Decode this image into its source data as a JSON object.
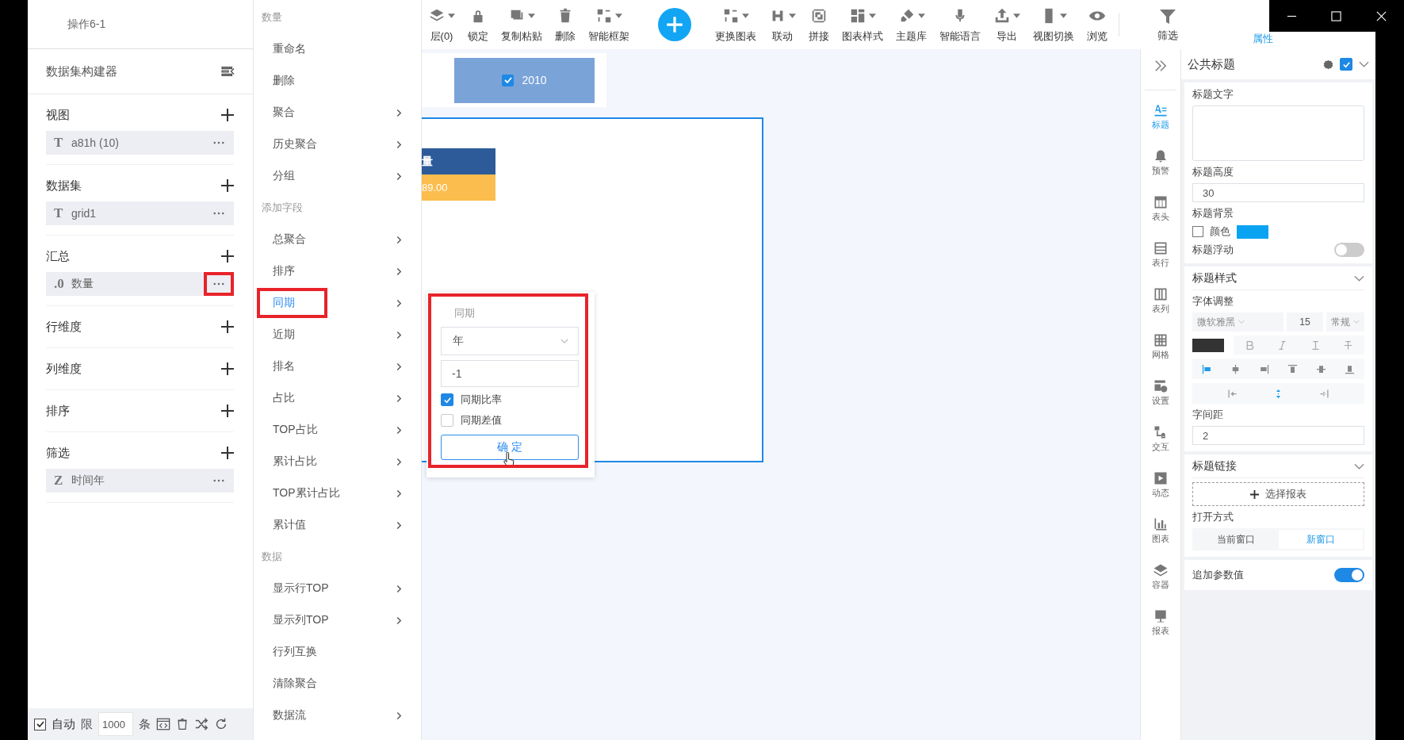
{
  "app_title": "操作6-1",
  "builder": {
    "title": "数据集构建器",
    "sections": [
      {
        "label": "视图",
        "fields": [
          {
            "type": "T",
            "name": "a81h (10)",
            "highlighted": false
          }
        ]
      },
      {
        "label": "数据集",
        "fields": [
          {
            "type": "T",
            "name": "grid1",
            "highlighted": false
          }
        ]
      },
      {
        "label": "汇总",
        "fields": [
          {
            "type": ".0",
            "name": "数量",
            "highlighted": true
          }
        ]
      },
      {
        "label": "行维度"
      },
      {
        "label": "列维度"
      },
      {
        "label": "排序"
      },
      {
        "label": "筛选",
        "fields": [
          {
            "type": "Z",
            "name": "时间年",
            "highlighted": false
          }
        ]
      }
    ],
    "footer": {
      "auto_checked": true,
      "auto_label": "自动",
      "limit_label": "限",
      "limit_value": "1000",
      "unit": "条"
    }
  },
  "context_menu": {
    "items": [
      {
        "kind": "group",
        "label": "数量"
      },
      {
        "kind": "item",
        "label": "重命名",
        "submenu": false,
        "selected": false
      },
      {
        "kind": "item",
        "label": "删除",
        "submenu": false,
        "selected": false
      },
      {
        "kind": "item",
        "label": "聚合",
        "submenu": true,
        "selected": false
      },
      {
        "kind": "item",
        "label": "历史聚合",
        "submenu": true,
        "selected": false
      },
      {
        "kind": "item",
        "label": "分组",
        "submenu": true,
        "selected": false
      },
      {
        "kind": "group",
        "label": "添加字段"
      },
      {
        "kind": "item",
        "label": "总聚合",
        "submenu": true,
        "selected": false
      },
      {
        "kind": "item",
        "label": "排序",
        "submenu": true,
        "selected": false
      },
      {
        "kind": "item",
        "label": "同期",
        "submenu": true,
        "selected": true
      },
      {
        "kind": "item",
        "label": "近期",
        "submenu": true,
        "selected": false
      },
      {
        "kind": "item",
        "label": "排名",
        "submenu": true,
        "selected": false
      },
      {
        "kind": "item",
        "label": "占比",
        "submenu": true,
        "selected": false
      },
      {
        "kind": "item",
        "label": "TOP占比",
        "submenu": true,
        "selected": false
      },
      {
        "kind": "item",
        "label": "累计占比",
        "submenu": true,
        "selected": false
      },
      {
        "kind": "item",
        "label": "TOP累计占比",
        "submenu": true,
        "selected": false
      },
      {
        "kind": "item",
        "label": "累计值",
        "submenu": true,
        "selected": false
      },
      {
        "kind": "group",
        "label": "数据"
      },
      {
        "kind": "item",
        "label": "显示行TOP",
        "submenu": true,
        "selected": false
      },
      {
        "kind": "item",
        "label": "显示列TOP",
        "submenu": true,
        "selected": false
      },
      {
        "kind": "item",
        "label": "行列互换",
        "submenu": false,
        "selected": false
      },
      {
        "kind": "item",
        "label": "清除聚合",
        "submenu": false,
        "selected": false
      },
      {
        "kind": "item",
        "label": "数据流",
        "submenu": true,
        "selected": false
      }
    ]
  },
  "toolbar": {
    "items": [
      {
        "kind": "tool",
        "label": "层(0)",
        "dropdown": true
      },
      {
        "kind": "tool",
        "label": "锁定",
        "dropdown": false
      },
      {
        "kind": "tool",
        "label": "复制粘贴",
        "dropdown": true
      },
      {
        "kind": "tool",
        "label": "删除",
        "dropdown": false
      },
      {
        "kind": "tool",
        "label": "智能框架",
        "dropdown": true
      },
      {
        "kind": "add"
      },
      {
        "kind": "tool",
        "label": "更换图表",
        "dropdown": true
      },
      {
        "kind": "tool",
        "label": "联动",
        "dropdown": true
      },
      {
        "kind": "tool",
        "label": "拼接",
        "dropdown": false
      },
      {
        "kind": "tool",
        "label": "图表样式",
        "dropdown": true
      },
      {
        "kind": "tool",
        "label": "主题库",
        "dropdown": true
      },
      {
        "kind": "tool",
        "label": "智能语言",
        "dropdown": false
      },
      {
        "kind": "tool",
        "label": "导出",
        "dropdown": true
      },
      {
        "kind": "tool",
        "label": "视图切换",
        "dropdown": true
      },
      {
        "kind": "tool",
        "label": "浏览",
        "dropdown": false
      }
    ],
    "tabs": [
      {
        "label": "筛选",
        "selected": false
      },
      {
        "label": "属性",
        "selected": true
      }
    ]
  },
  "canvas": {
    "filter_chip": {
      "label": "2010",
      "checked": true
    },
    "table": {
      "header": "量",
      "value": "89.00"
    }
  },
  "popup": {
    "title": "同期",
    "select": "年",
    "input": "-1",
    "highlighted": true,
    "options": [
      {
        "label": "同期比率",
        "checked": true
      },
      {
        "label": "同期差值",
        "checked": false
      }
    ],
    "button": "确 定"
  },
  "side_tabs": [
    {
      "label": "标题",
      "selected": true
    },
    {
      "label": "预警",
      "selected": false
    },
    {
      "label": "表头",
      "selected": false
    },
    {
      "label": "表行",
      "selected": false
    },
    {
      "label": "表列",
      "selected": false
    },
    {
      "label": "网格",
      "selected": false
    },
    {
      "label": "设置",
      "selected": false
    },
    {
      "label": "交互",
      "selected": false
    },
    {
      "label": "动态",
      "selected": false
    },
    {
      "label": "图表",
      "selected": false
    },
    {
      "label": "容器",
      "selected": false
    },
    {
      "label": "报表",
      "selected": false
    }
  ],
  "properties": {
    "title": "公共标题",
    "enabled": true,
    "text_label": "标题文字",
    "height_label": "标题高度",
    "height_value": "30",
    "bg_label": "标题背景",
    "bg_checked": false,
    "bg_color_label": "颜色",
    "float_label": "标题浮动",
    "float_on": false,
    "style_title": "标题样式",
    "font_label": "字体调整",
    "font": "微软雅黑",
    "size": "15",
    "weight": "常规",
    "align_buttons": [
      {
        "selected": true
      },
      {
        "selected": false
      },
      {
        "selected": false
      },
      {
        "selected": false
      },
      {
        "selected": false
      },
      {
        "selected": false
      }
    ],
    "indent_buttons": [
      {
        "selected": false
      },
      {
        "selected": true
      },
      {
        "selected": false
      }
    ],
    "spacing_label": "字间距",
    "spacing_value": "2",
    "link_title": "标题链接",
    "select_report": "选择报表",
    "open_label": "打开方式",
    "open_modes": [
      {
        "label": "当前窗口",
        "selected": false
      },
      {
        "label": "新窗口",
        "selected": true
      }
    ],
    "append_label": "追加参数值",
    "append_on": true
  }
}
